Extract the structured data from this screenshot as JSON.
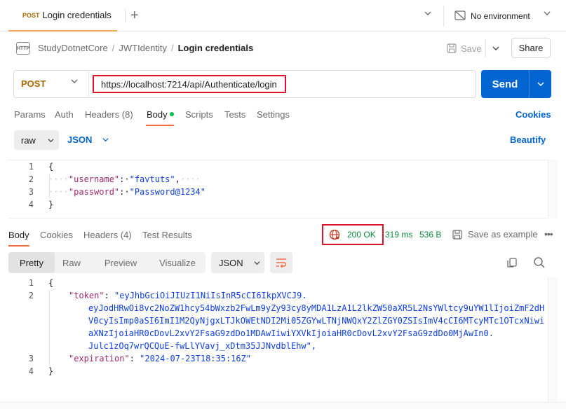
{
  "tab": {
    "method": "POST",
    "title": "Login credentials"
  },
  "environment": {
    "label": "No environment"
  },
  "breadcrumb": {
    "icon_text": "HTTP",
    "items": [
      "StudyDotnetCore",
      "JWTIdentity",
      "Login credentials"
    ],
    "separator": "/"
  },
  "toolbar": {
    "save_label": "Save",
    "share_label": "Share"
  },
  "request": {
    "method": "POST",
    "url": "https://localhost:7214/api/Authenticate/login",
    "send_label": "Send",
    "tabs": [
      {
        "label": "Params"
      },
      {
        "label": "Auth"
      },
      {
        "label": "Headers",
        "count": "(8)"
      },
      {
        "label": "Body"
      },
      {
        "label": "Scripts"
      },
      {
        "label": "Tests"
      },
      {
        "label": "Settings"
      }
    ],
    "cookies_label": "Cookies",
    "body_mode": "raw",
    "body_language": "JSON",
    "beautify_label": "Beautify",
    "body_lines": [
      {
        "n": "1",
        "text": "{"
      },
      {
        "n": "2",
        "key": "\"username\"",
        "value": "\"favtuts\""
      },
      {
        "n": "3",
        "key": "\"password\"",
        "value": "\"Password@1234\""
      },
      {
        "n": "4",
        "text": "}"
      }
    ]
  },
  "response": {
    "tabs": [
      {
        "label": "Body"
      },
      {
        "label": "Cookies"
      },
      {
        "label": "Headers",
        "count": "(4)"
      },
      {
        "label": "Test Results"
      }
    ],
    "status": "200 OK",
    "time": "319 ms",
    "size": "536 B",
    "save_example_label": "Save as example",
    "view_modes": [
      "Pretty",
      "Raw",
      "Preview",
      "Visualize"
    ],
    "language": "JSON",
    "lines": {
      "l1": "{",
      "token_key": "\"token\"",
      "token_parts": [
        "\"eyJhbGciOiJIUzI1NiIsInR5cCI6IkpXVCJ9.",
        "eyJodHRwOi8vc2NoZW1hcy54bWxzb2FwLm9yZy93cy8yMDA1LzA1L2lkZW50aXR5L2NsYWltcy9uYW1lIjoiZmF2dH",
        "V0cyIsImp0aSI6ImI1M2QyNjgxLTJkOWEtNDI2Mi05ZGYwLTNjNWQxY2ZlZGY0ZSIsImV4cCI6MTcyMTc1OTcxNiwi",
        "aXNzIjoiaHR0cDovL2xvY2FsaG9zdDo1MDAwIiwiYXVkIjoiaHR0cDovL2xvY2FsaG9zdDo0MjAwIn0.",
        "Julc1zOq7wrQCQuE-fwLlYVavj_xDtm35JJNvdblEhw\","
      ],
      "exp_key": "\"expiration\"",
      "exp_value": "\"2024-07-23T18:35:16Z\"",
      "l4": "}"
    }
  }
}
